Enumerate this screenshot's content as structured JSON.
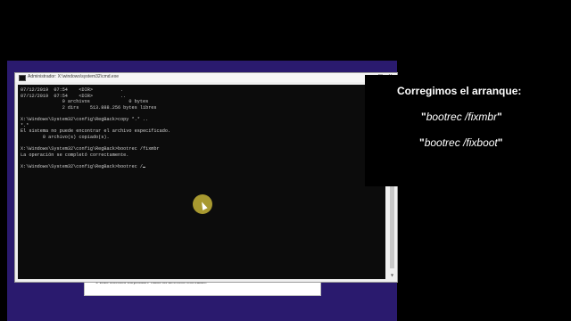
{
  "window": {
    "title": "Administrador: X:\\windows\\system32\\cmd.exe"
  },
  "console": {
    "lines": [
      "07/12/2019  07:54    <DIR>          .",
      "07/12/2019  07:54    <DIR>          ..",
      "               0 archivos              0 bytes",
      "               2 dirs    513.888.256 bytes libres",
      "",
      "X:\\Windows\\System32\\config\\RegBack>copy *.* ..",
      "*.*",
      "El sistema no puede encontrar el archivo especificado.",
      "        0 archivo(s) copiado(s).",
      "",
      "X:\\Windows\\System32\\config\\RegBack>bootrec /fixmbr",
      "La operación se completó correctamente.",
      ""
    ],
    "current_input": "X:\\Windows\\System32\\config\\RegBack>bootrec /"
  },
  "setup": {
    "copyright": "© 2020 Microsoft Corporation. Todos los derechos reservados."
  },
  "overlay": {
    "heading": "Corregimos el arranque:",
    "commands": [
      "bootrec /fixmbr",
      "bootrec /fixboot"
    ],
    "quote": "\""
  },
  "icons": {
    "cursor_highlight": "cursor-highlight-icon",
    "pointer": "mouse-pointer-icon"
  }
}
